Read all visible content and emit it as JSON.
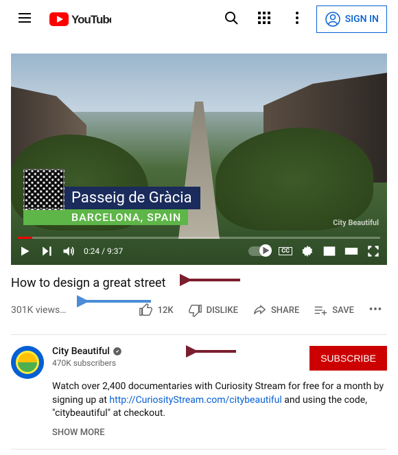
{
  "header": {
    "logo_text": "YouTube",
    "signin_label": "Sign In"
  },
  "player": {
    "caption_line1": "Passeig de Gràcia",
    "caption_line2": "BARCELONA, SPAIN",
    "watermark": "City Beautiful",
    "time": "0:24 / 9:37"
  },
  "video": {
    "title": "How to design a great street",
    "views": "301K views…",
    "like_count": "12K",
    "dislike_label": "DISLIKE",
    "share_label": "SHARE",
    "save_label": "SAVE"
  },
  "channel": {
    "name": "City Beautiful",
    "subscribers": "470K subscribers",
    "subscribe_label": "Subscribe",
    "description_pre": "Watch over 2,400 documentaries with Curiosity Stream for free for a month by signing up at ",
    "description_link": "http://CuriosityStream.com/citybeautiful",
    "description_post": " and using the code, \"citybeautiful\" at checkout.",
    "show_more": "SHOW MORE"
  },
  "colors": {
    "youtube_red": "#ff0000",
    "link_blue": "#065fd4",
    "subscribe_red": "#cc0000"
  }
}
